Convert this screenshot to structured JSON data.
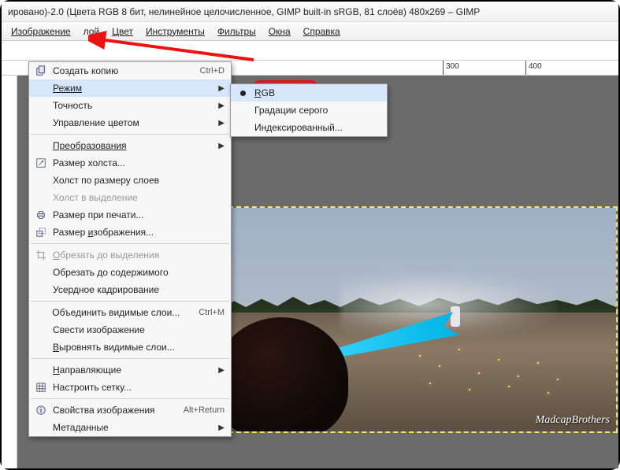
{
  "title": "ировано)-2.0 (Цвета RGB 8 бит, нелинейное целочисленное, GIMP built-in sRGB, 81 слоёв) 480x269 – GIMP",
  "menubar": {
    "image": "Изображение",
    "layer": "лой",
    "color": "Цвет",
    "tools": "Инструменты",
    "filters": "Фильтры",
    "windows": "Окна",
    "help": "Справка"
  },
  "menu": {
    "duplicate": {
      "label": "Создать копию",
      "shortcut": "Ctrl+D"
    },
    "mode": {
      "label": "Режим"
    },
    "precision": {
      "label": "Точность"
    },
    "color_mgmt": {
      "label": "Управление цветом"
    },
    "transform": {
      "label": "Преобразования"
    },
    "canvas_size": {
      "label": "Размер холста..."
    },
    "fit_canvas": {
      "label": "Холст по размеру слоев"
    },
    "canvas_to_sel": {
      "label": "Холст в выделение"
    },
    "print_size": {
      "label": "Размер при печати..."
    },
    "scale": {
      "label": "Размер изображения..."
    },
    "crop_sel": {
      "label": "Обрезать до выделения"
    },
    "crop_content": {
      "label": "Обрезать до содержимого"
    },
    "zealous": {
      "label": "Усердное кадрирование"
    },
    "merge_visible": {
      "label": "Объединить видимые слои...",
      "shortcut": "Ctrl+M"
    },
    "flatten": {
      "label": "Свести изображение"
    },
    "align_layers": {
      "label": "Выровнять видимые слои..."
    },
    "guides": {
      "label": "Направляющие"
    },
    "grid": {
      "label": "Настроить сетку..."
    },
    "properties": {
      "label": "Свойства изображения",
      "shortcut": "Alt+Return"
    },
    "metadata": {
      "label": "Метаданные"
    }
  },
  "submenu": {
    "rgb": "RGB",
    "grayscale": "Градации серого",
    "indexed": "Индексированный..."
  },
  "ruler_marks": [
    "300",
    "400"
  ],
  "watermark": "MadcapBrothers"
}
